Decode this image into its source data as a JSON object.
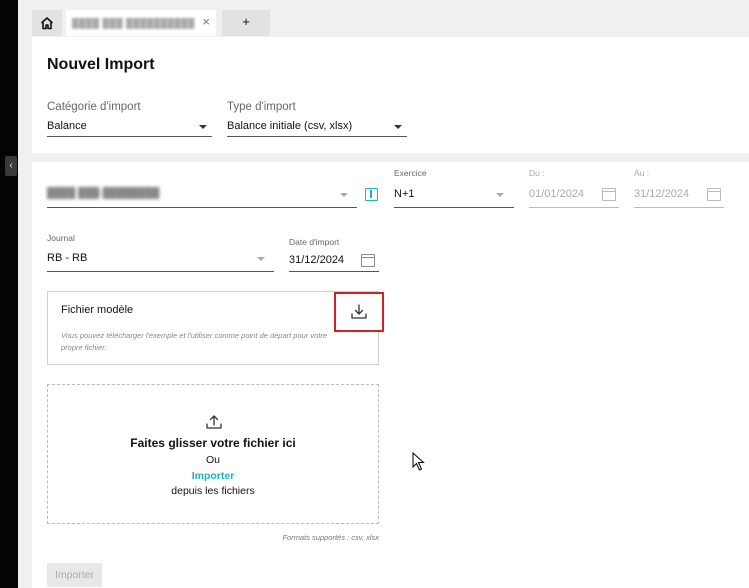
{
  "tabs": {
    "home_icon": "home-icon",
    "doc_title": "████ ███ ██████████",
    "close_glyph": "×",
    "add_label": "+"
  },
  "header": {
    "title": "Nouvel Import",
    "import_category_label": "Catégorie d'import",
    "import_category_value": "Balance",
    "import_type_label": "Type d'import",
    "import_type_value": "Balance initiale (csv, xlsx)"
  },
  "form": {
    "company_value": "████ ███-████████",
    "exercise_label": "Exercice",
    "exercise_value": "N+1",
    "from_label": "Du :",
    "from_value": "01/01/2024",
    "to_label": "Au :",
    "to_value": "31/12/2024",
    "journal_label": "Journal",
    "journal_value": "RB - RB",
    "import_date_label": "Date d'import",
    "import_date_value": "31/12/2024"
  },
  "model_file": {
    "title": "Fichier modèle",
    "description": "Vous pouvez télécharger l'exemple et l'utiliser comme point de départ pour votre propre fichier."
  },
  "dropzone": {
    "title": "Faites glisser votre fichier ici",
    "or": "Ou",
    "link": "Importer",
    "from_files": "depuis les fichiers"
  },
  "formats": "Formats supportés : csv, xlsx",
  "import_button": "Importer",
  "colors": {
    "accent": "#1ab5c2",
    "highlight": "#d42020"
  }
}
